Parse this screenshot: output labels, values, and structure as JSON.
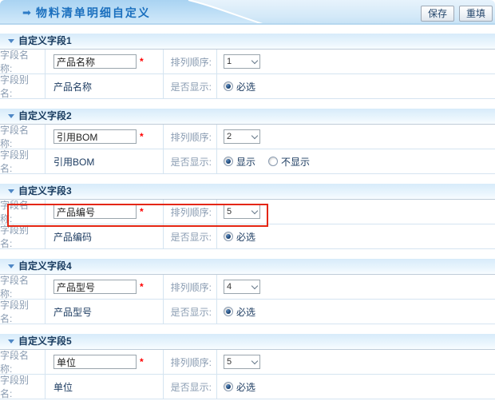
{
  "page": {
    "title": "物料清单明细自定义"
  },
  "toolbar": {
    "save_label": "保存",
    "reset_label": "重填"
  },
  "labels": {
    "field_name": "字段名称:",
    "sort_order": "排列顺序:",
    "field_alias": "字段别名:",
    "display": "是否显示:"
  },
  "icons": {
    "title_arrow": "➡"
  },
  "colors": {
    "title_blue": "#1a6fbe",
    "section_title_navy": "#173a5e",
    "label_gray_blue": "#8a9cb2",
    "value_navy": "#1e3d62",
    "highlight_red": "#e42613",
    "required_asterisk_red": "#ff0000",
    "bar_blue": "#a9d3f2"
  },
  "sections": [
    {
      "title": "自定义字段1",
      "field_name_value": "产品名称",
      "sort_order_value": "1",
      "field_alias_value": "产品名称",
      "display_options": [
        {
          "label": "必选",
          "selected": true
        }
      ],
      "highlighted": false
    },
    {
      "title": "自定义字段2",
      "field_name_value": "引用BOM",
      "sort_order_value": "2",
      "field_alias_value": "引用BOM",
      "display_options": [
        {
          "label": "显示",
          "selected": true
        },
        {
          "label": "不显示",
          "selected": false
        }
      ],
      "highlighted": false
    },
    {
      "title": "自定义字段3",
      "field_name_value": "产品编号",
      "sort_order_value": "5",
      "field_alias_value": "产品编码",
      "display_options": [
        {
          "label": "必选",
          "selected": true
        }
      ],
      "highlighted": true
    },
    {
      "title": "自定义字段4",
      "field_name_value": "产品型号",
      "sort_order_value": "4",
      "field_alias_value": "产品型号",
      "display_options": [
        {
          "label": "必选",
          "selected": true
        }
      ],
      "highlighted": false
    },
    {
      "title": "自定义字段5",
      "field_name_value": "单位",
      "sort_order_value": "5",
      "field_alias_value": "单位",
      "display_options": [
        {
          "label": "必选",
          "selected": true
        }
      ],
      "highlighted": false
    }
  ]
}
